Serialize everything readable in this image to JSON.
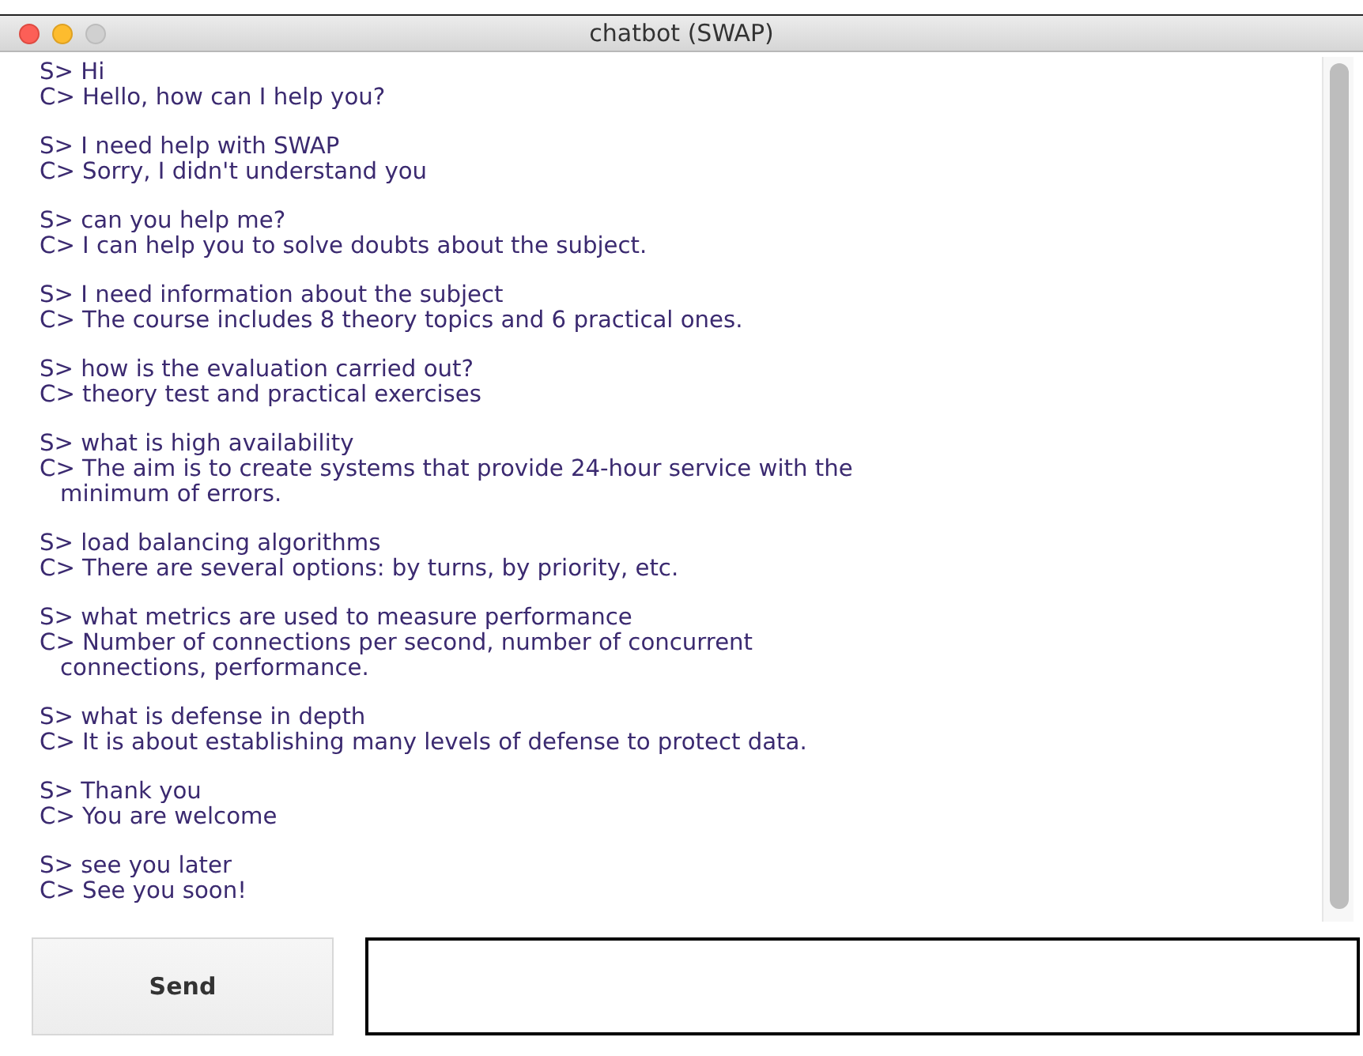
{
  "window": {
    "title": "chatbot (SWAP)"
  },
  "conversation": [
    {
      "lines": [
        [
          "S> Hi"
        ],
        [
          "C> Hello, how can I help you?"
        ]
      ]
    },
    {
      "lines": [
        [
          "S> I need help with SWAP"
        ],
        [
          "C> Sorry, I didn't understand you"
        ]
      ]
    },
    {
      "lines": [
        [
          "S> can you help me?"
        ],
        [
          "C> I can help you to solve doubts about the subject."
        ]
      ]
    },
    {
      "lines": [
        [
          "S> I need information about the subject"
        ],
        [
          "C> The course includes 8 theory topics and 6 practical ones."
        ]
      ]
    },
    {
      "lines": [
        [
          "S> how is the evaluation carried out?"
        ],
        [
          "C> theory test and practical exercises"
        ]
      ]
    },
    {
      "lines": [
        [
          "S> what is high availability"
        ],
        [
          "C> The aim is to create systems that provide 24-hour service with the",
          "minimum of errors."
        ]
      ]
    },
    {
      "lines": [
        [
          "S> load balancing algorithms"
        ],
        [
          "C> There are several options: by turns, by priority, etc."
        ]
      ]
    },
    {
      "lines": [
        [
          "S> what metrics are used to measure performance"
        ],
        [
          "C> Number of connections per second, number of concurrent",
          "connections, performance."
        ]
      ]
    },
    {
      "lines": [
        [
          "S> what is defense in depth"
        ],
        [
          "C> It is about establishing many levels of defense to protect data."
        ]
      ]
    },
    {
      "lines": [
        [
          "S> Thank you"
        ],
        [
          "C> You are welcome"
        ]
      ]
    },
    {
      "lines": [
        [
          "S> see you later"
        ],
        [
          "C> See you soon!"
        ]
      ]
    }
  ],
  "send_button": "Send"
}
